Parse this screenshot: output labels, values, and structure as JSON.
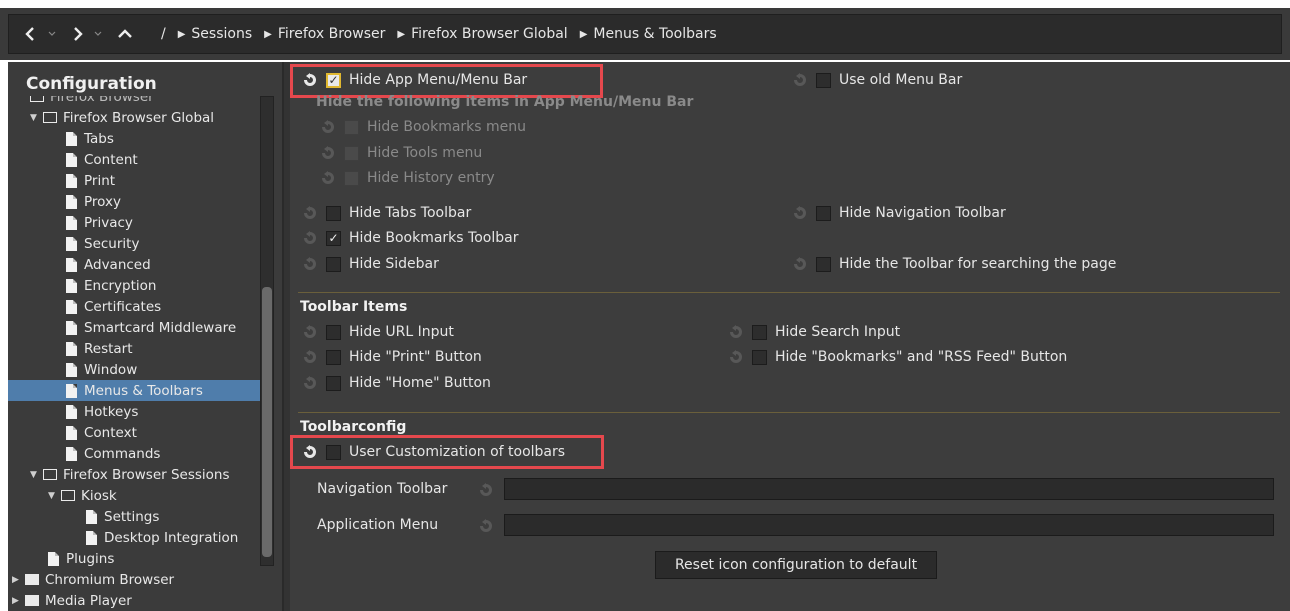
{
  "breadcrumb": {
    "root": "/",
    "items": [
      "Sessions",
      "Firefox Browser",
      "Firefox Browser Global",
      "Menus & Toolbars"
    ]
  },
  "sidebar": {
    "title": "Configuration",
    "items": [
      {
        "label": "Firefox Browser"
      },
      {
        "label": "Firefox Browser Global"
      },
      {
        "label": "Tabs"
      },
      {
        "label": "Content"
      },
      {
        "label": "Print"
      },
      {
        "label": "Proxy"
      },
      {
        "label": "Privacy"
      },
      {
        "label": "Security"
      },
      {
        "label": "Advanced"
      },
      {
        "label": "Encryption"
      },
      {
        "label": "Certificates"
      },
      {
        "label": "Smartcard Middleware"
      },
      {
        "label": "Restart"
      },
      {
        "label": "Window"
      },
      {
        "label": "Menus & Toolbars"
      },
      {
        "label": "Hotkeys"
      },
      {
        "label": "Context"
      },
      {
        "label": "Commands"
      },
      {
        "label": "Firefox Browser Sessions"
      },
      {
        "label": "Kiosk"
      },
      {
        "label": "Settings"
      },
      {
        "label": "Desktop Integration"
      },
      {
        "label": "Plugins"
      },
      {
        "label": "Chromium Browser"
      },
      {
        "label": "Media Player"
      }
    ]
  },
  "main": {
    "hide_app_menu": "Hide App Menu/Menu Bar",
    "use_old_menu": "Use old Menu Bar",
    "hide_following": "Hide the following items in App Menu/Menu Bar",
    "hide_bookmarks_menu": "Hide Bookmarks menu",
    "hide_tools_menu": "Hide Tools menu",
    "hide_history": "Hide History entry",
    "hide_tabs_toolbar": "Hide Tabs Toolbar",
    "hide_nav_toolbar": "Hide Navigation Toolbar",
    "hide_bookmarks_toolbar": "Hide Bookmarks Toolbar",
    "hide_sidebar": "Hide Sidebar",
    "hide_search_toolbar": "Hide the Toolbar for searching the page",
    "toolbar_items_title": "Toolbar Items",
    "hide_url": "Hide URL Input",
    "hide_search_input": "Hide Search Input",
    "hide_print": "Hide \"Print\" Button",
    "hide_bookmarks_rss": "Hide \"Bookmarks\" and \"RSS Feed\" Button",
    "hide_home": "Hide \"Home\" Button",
    "toolbarconfig_title": "Toolbarconfig",
    "user_customization": "User Customization of toolbars",
    "nav_toolbar_label": "Navigation Toolbar",
    "app_menu_label": "Application Menu",
    "reset_icons_button": "Reset icon configuration to default"
  },
  "colors": {
    "selection": "#4f7dab",
    "highlight": "#e5484d",
    "checkbox_accent": "#e0b830"
  }
}
